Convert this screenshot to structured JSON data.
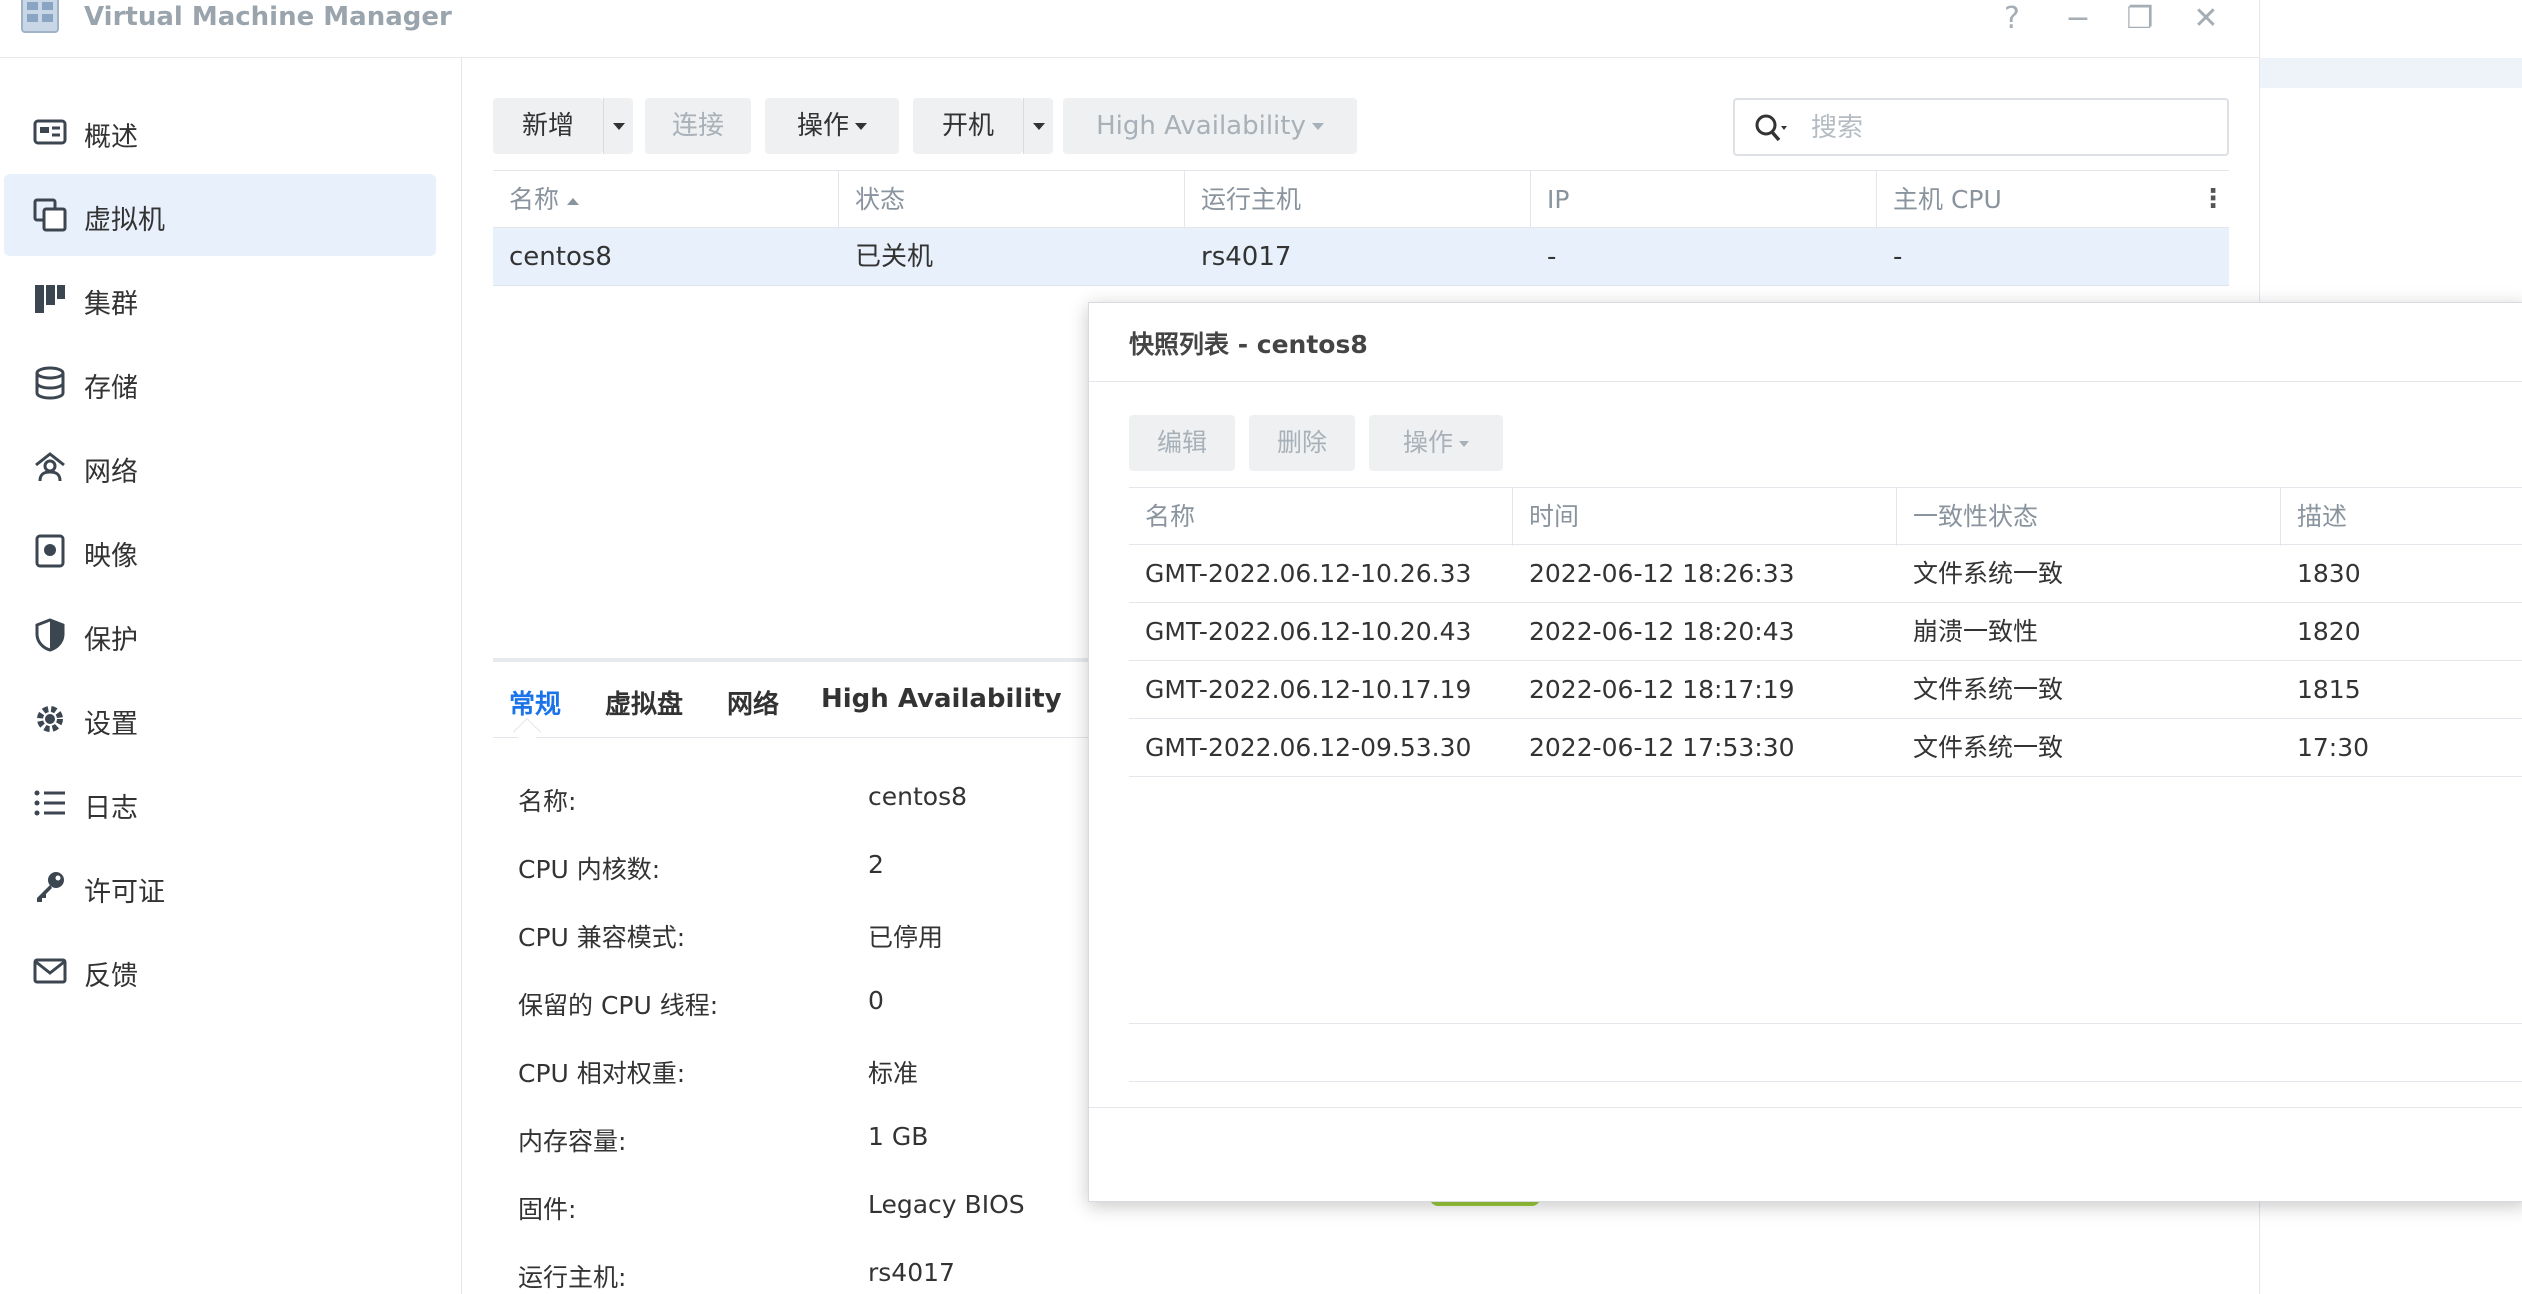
{
  "window": {
    "title": "Virtual Machine Manager",
    "controls": {
      "help": "?",
      "minimize": "−",
      "maximize": "❐",
      "close": "✕"
    }
  },
  "sidebar": {
    "items": [
      {
        "label": "概述",
        "icon": "overview-icon",
        "active": false
      },
      {
        "label": "虚拟机",
        "icon": "virtual-machine-icon",
        "active": true
      },
      {
        "label": "集群",
        "icon": "cluster-icon",
        "active": false
      },
      {
        "label": "存储",
        "icon": "storage-icon",
        "active": false
      },
      {
        "label": "网络",
        "icon": "network-icon",
        "active": false
      },
      {
        "label": "映像",
        "icon": "image-icon",
        "active": false
      },
      {
        "label": "保护",
        "icon": "shield-icon",
        "active": false
      },
      {
        "label": "设置",
        "icon": "gear-icon",
        "active": false
      },
      {
        "label": "日志",
        "icon": "log-list-icon",
        "active": false
      },
      {
        "label": "许可证",
        "icon": "key-icon",
        "active": false
      },
      {
        "label": "反馈",
        "icon": "mail-icon",
        "active": false
      }
    ]
  },
  "toolbar": {
    "create_label": "新增",
    "connect_label": "连接",
    "action_label": "操作",
    "power_on_label": "开机",
    "ha_label": "High Availability"
  },
  "search": {
    "placeholder": "搜索",
    "value": ""
  },
  "vm_table": {
    "columns": [
      "名称",
      "状态",
      "运行主机",
      "IP",
      "主机 CPU"
    ],
    "rows": [
      {
        "name": "centos8",
        "status": "已关机",
        "host": "rs4017",
        "ip": "-",
        "cpu": "-"
      }
    ]
  },
  "detail": {
    "tabs": [
      "常规",
      "虚拟盘",
      "网络",
      "High Availability"
    ],
    "active_tab": "常规",
    "fields": [
      {
        "label": "名称:",
        "value": "centos8"
      },
      {
        "label": "CPU 内核数:",
        "value": "2"
      },
      {
        "label": "CPU 兼容模式:",
        "value": "已停用"
      },
      {
        "label": "保留的 CPU 线程:",
        "value": "0"
      },
      {
        "label": "CPU 相对权重:",
        "value": "标准"
      },
      {
        "label": "内存容量:",
        "value": "1 GB"
      },
      {
        "label": "固件:",
        "value": "Legacy BIOS"
      },
      {
        "label": "运行主机:",
        "value": "rs4017"
      }
    ]
  },
  "snapshot_dialog": {
    "title": "快照列表 - centos8",
    "buttons": {
      "edit": "编辑",
      "delete": "删除",
      "action": "操作"
    },
    "columns": [
      "名称",
      "时间",
      "一致性状态",
      "描述"
    ],
    "rows": [
      {
        "name": "GMT-2022.06.12-10.26.33",
        "time": "2022-06-12 18:26:33",
        "consistency": "文件系统一致",
        "description": "1830"
      },
      {
        "name": "GMT-2022.06.12-10.20.43",
        "time": "2022-06-12 18:20:43",
        "consistency": "崩溃一致性",
        "description": "1820"
      },
      {
        "name": "GMT-2022.06.12-10.17.19",
        "time": "2022-06-12 18:17:19",
        "consistency": "文件系统一致",
        "description": "1815"
      },
      {
        "name": "GMT-2022.06.12-09.53.30",
        "time": "2022-06-12 17:53:30",
        "consistency": "文件系统一致",
        "description": "17:30"
      }
    ]
  },
  "colors": {
    "accent": "#1a73e8",
    "active_bg": "#e8f0fb",
    "button_bg": "#eef0f2",
    "disabled_text": "#a8b0b8",
    "header_text": "#8a949e"
  }
}
